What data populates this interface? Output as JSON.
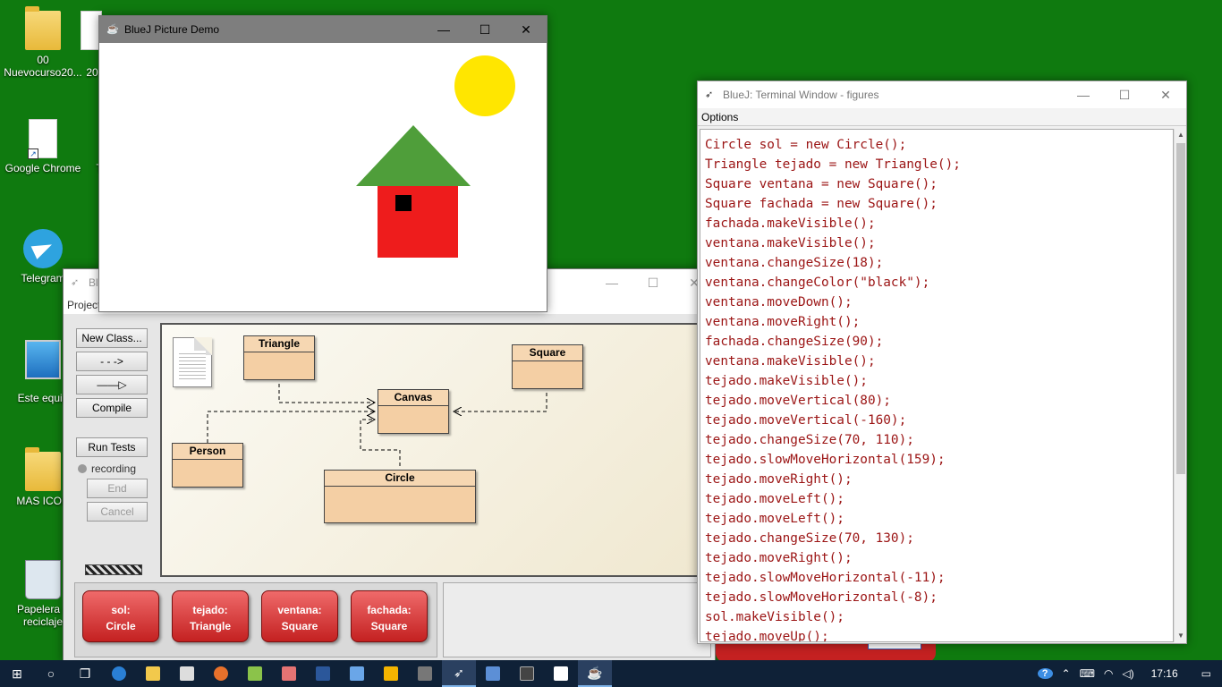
{
  "desktop": {
    "icons": [
      {
        "label": "00\nNuevocurso20...",
        "kind": "folder"
      },
      {
        "label": "20",
        "kind": "folder"
      },
      {
        "label": "Google Chrome",
        "kind": "doc"
      },
      {
        "label": "T",
        "kind": "doc"
      },
      {
        "label": "Telegram",
        "kind": "telegram"
      },
      {
        "label": "Este equip",
        "kind": "pc"
      },
      {
        "label": "MAS ICON",
        "kind": "folder"
      },
      {
        "label": "Papelera d\nreciclaje",
        "kind": "bin"
      }
    ]
  },
  "picture_window": {
    "title": "BlueJ Picture Demo",
    "colors": {
      "sun": "#ffe600",
      "roof": "#4f9e3a",
      "wall": "#ee1c1c",
      "window": "#000000"
    }
  },
  "bluej_window": {
    "title": "Bl",
    "menu": "Project",
    "buttons": {
      "new_class": "New Class...",
      "arrow_dashed": "- - ->",
      "arrow_solid": "——▷",
      "compile": "Compile",
      "run_tests": "Run Tests",
      "recording": "recording",
      "end": "End",
      "cancel": "Cancel"
    },
    "classes": {
      "triangle": "Triangle",
      "square": "Square",
      "canvas": "Canvas",
      "person": "Person",
      "circle": "Circle"
    },
    "objects": [
      {
        "name": "sol:",
        "type": "Circle"
      },
      {
        "name": "tejado:",
        "type": "Triangle"
      },
      {
        "name": "ventana:",
        "type": "Square"
      },
      {
        "name": "fachada:",
        "type": "Square"
      }
    ]
  },
  "terminal_window": {
    "title": "BlueJ: Terminal Window - figures",
    "menu": "Options",
    "lines": [
      "Circle sol = new Circle();",
      "Triangle tejado = new Triangle();",
      "Square ventana = new Square();",
      "Square fachada = new Square();",
      "fachada.makeVisible();",
      "ventana.makeVisible();",
      "ventana.changeSize(18);",
      "ventana.changeColor(\"black\");",
      "ventana.moveDown();",
      "ventana.moveRight();",
      "fachada.changeSize(90);",
      "ventana.makeVisible();",
      "tejado.makeVisible();",
      "tejado.moveVertical(80);",
      "tejado.moveVertical(-160);",
      "tejado.changeSize(70, 110);",
      "tejado.slowMoveHorizontal(159);",
      "tejado.moveRight();",
      "tejado.moveLeft();",
      "tejado.moveLeft();",
      "tejado.changeSize(70, 130);",
      "tejado.moveRight();",
      "tejado.slowMoveHorizontal(-11);",
      "tejado.slowMoveHorizontal(-8);",
      "sol.makeVisible();",
      "tejado.moveUp();"
    ]
  },
  "taskbar": {
    "time": "17:16",
    "apps": [
      "start",
      "search",
      "task-view",
      "edge",
      "file-explorer",
      "store",
      "firefox",
      "app",
      "app",
      "word",
      "app",
      "app",
      "app",
      "bluej",
      "app",
      "app",
      "notepad",
      "java"
    ]
  }
}
